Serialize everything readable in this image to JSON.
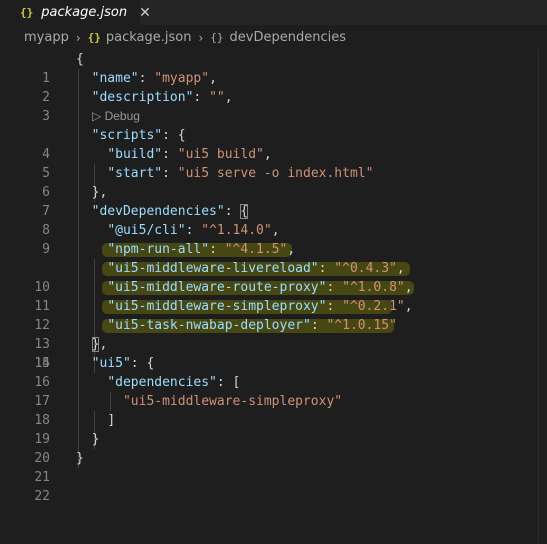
{
  "tab": {
    "icon": "{}",
    "label": "package.json",
    "close": "✕"
  },
  "breadcrumb": {
    "root": "myapp",
    "sep": "›",
    "file_icon": "{}",
    "file": "package.json",
    "symbol_icon": "{}",
    "symbol": "devDependencies"
  },
  "codelens": "▷ Debug",
  "lines": {
    "n1": "1",
    "n2": "2",
    "n3": "3",
    "n4": "4",
    "n5": "5",
    "n6": "6",
    "n7": "7",
    "n8": "8",
    "n9": "9",
    "n10": "10",
    "n11": "11",
    "n12": "12",
    "n13": "13",
    "n14": "14",
    "n15": "15",
    "n16": "16",
    "n17": "17",
    "n18": "18",
    "n19": "19",
    "n20": "20",
    "n21": "21",
    "n22": "22"
  },
  "code": {
    "open": "{",
    "name_key": "\"name\"",
    "name_val": "\"myapp\"",
    "desc_key": "\"description\"",
    "desc_val": "\"\"",
    "scripts_key": "\"scripts\"",
    "build_key": "\"build\"",
    "build_val": "\"ui5 build\"",
    "start_key": "\"start\"",
    "start_val": "\"ui5 serve -o index.html\"",
    "dev_key": "\"devDependencies\"",
    "d1_key": "\"@ui5/cli\"",
    "d1_val": "\"^1.14.0\"",
    "d2_key": "\"npm-run-all\"",
    "d2_val": "\"^4.1.5\"",
    "d3_key": "\"ui5-middleware-livereload\"",
    "d3_val": "\"^0.4.3\"",
    "d4_key": "\"ui5-middleware-route-proxy\"",
    "d4_val": "\"^1.0.8\"",
    "d5_key": "\"ui5-middleware-simpleproxy\"",
    "d5_val": "\"^0.2.1\"",
    "d6_key": "\"ui5-task-nwabap-deployer\"",
    "d6_val": "\"^1.0.15\"",
    "ui5_key": "\"ui5\"",
    "deps_key": "\"dependencies\"",
    "dep_item": "\"ui5-middleware-simpleproxy\"",
    "close_bracket": "]",
    "close_brace": "}"
  },
  "colors": {
    "key": "#9cdcfe",
    "string": "#ce9178",
    "highlight": "#969600"
  }
}
